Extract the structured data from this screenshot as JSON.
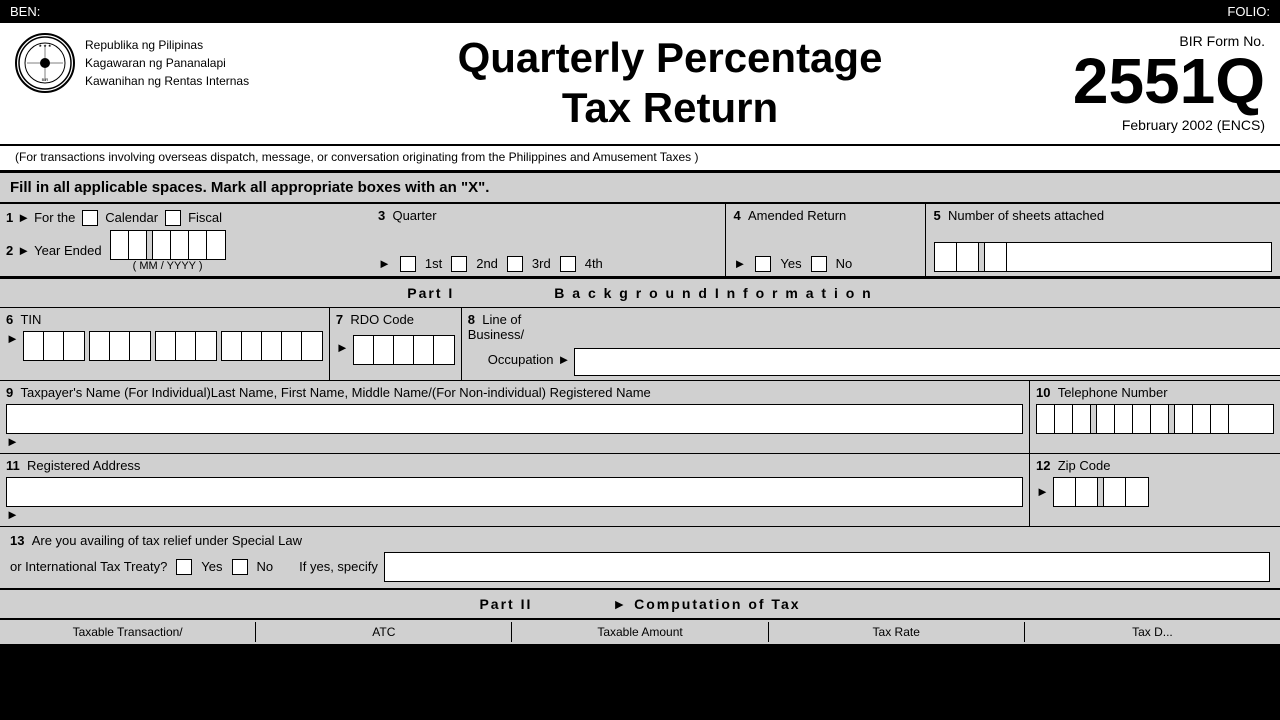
{
  "topbar": {
    "left": "BEN:",
    "right": "FOLIO:"
  },
  "header": {
    "org_line1": "Republika ng Pilipinas",
    "org_line2": "Kagawaran ng Pananalapi",
    "org_line3": "Kawanihan ng Rentas Internas",
    "title_line1": "Quarterly Percentage",
    "title_line2": "Tax Return",
    "form_no_label": "BIR Form No.",
    "form_no": "2551Q",
    "form_date": "February 2002 (ENCS)"
  },
  "note": {
    "text": "(For transactions involving overseas dispatch, message, or conversation originating from the Philippines and Amusement Taxes )"
  },
  "instruction": {
    "text": "Fill in all applicable spaces. Mark all appropriate boxes with an \"X\"."
  },
  "fields": {
    "field1_number": "1",
    "field1_label": "For the",
    "field1_calendar": "Calendar",
    "field1_fiscal": "Fiscal",
    "field2_number": "2",
    "field2_label": "Year Ended",
    "field2_sub": "( MM / YYYY )",
    "field3_number": "3",
    "field3_label": "Quarter",
    "field3_1st": "1st",
    "field3_2nd": "2nd",
    "field3_3rd": "3rd",
    "field3_4th": "4th",
    "field4_number": "4",
    "field4_label": "Amended Return",
    "field4_yes": "Yes",
    "field4_no": "No",
    "field5_number": "5",
    "field5_label": "Number of sheets attached"
  },
  "part1": {
    "label": "Part I",
    "title": "B a c k g r o u n d   I n f o r m a t i o n",
    "field6_number": "6",
    "field6_label": "TIN",
    "field7_number": "7",
    "field7_label": "RDO Code",
    "field8_number": "8",
    "field8_label": "Line of  Business/",
    "field8_sub": "Occupation",
    "field9_number": "9",
    "field9_label": "Taxpayer's Name (For Individual)Last Name, First Name, Middle Name/(For Non-individual) Registered Name",
    "field10_number": "10",
    "field10_label": "Telephone Number",
    "field11_number": "11",
    "field11_label": "Registered Address",
    "field12_number": "12",
    "field12_label": "Zip Code",
    "field13_number": "13",
    "field13_line1": "Are you availing of tax relief under Special Law",
    "field13_line2": "or International Tax Treaty?",
    "field13_yes": "Yes",
    "field13_no": "No",
    "field13_ifyes": "If yes, specify"
  },
  "part2": {
    "label": "Part II",
    "arrow": "►",
    "title": "► Computation of Tax"
  },
  "bottom_cols": {
    "col1": "Taxable Transaction/",
    "col2": "ATC",
    "col3": "Taxable Amount",
    "col4": "Tax Rate",
    "col5": "Tax D..."
  }
}
